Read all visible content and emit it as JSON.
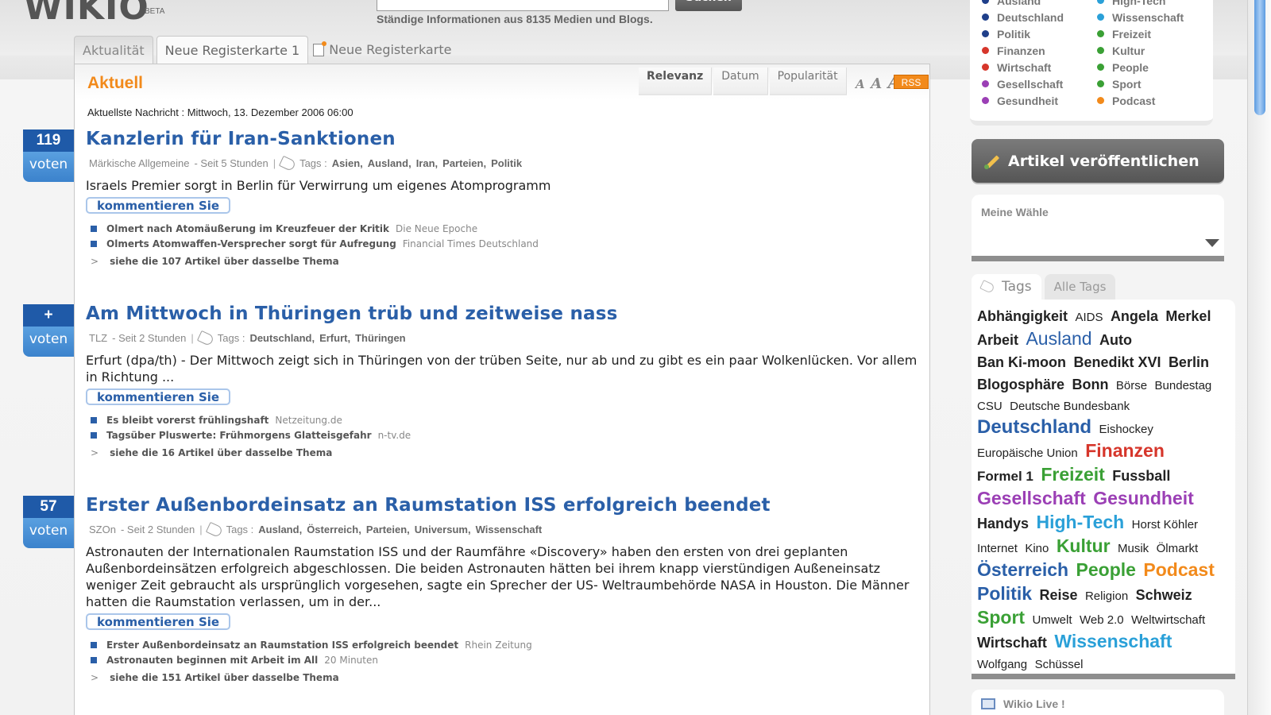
{
  "header": {
    "logo_text": "WIKIO",
    "beta_label": "BETA",
    "search_button": "Suchen",
    "search_value": "",
    "search_info": "Ständige Informationen aus 8135 Medien und Blogs."
  },
  "tabs": [
    {
      "label": "Aktualität",
      "active": true
    },
    {
      "label": "Neue Registerkarte 1",
      "active": false
    },
    {
      "label": "Neue Registerkarte",
      "active": false,
      "new": true
    }
  ],
  "main": {
    "section_title": "Aktuell",
    "sort_tabs": [
      "Relevanz",
      "Datum",
      "Popularität"
    ],
    "font_size_labels": [
      "A",
      "A",
      "A"
    ],
    "rss_label": "RSS",
    "latest_label": "Aktuellste Nachricht : Mittwoch, 13. Dezember 2006 06:00"
  },
  "articles": [
    {
      "vote_count": "119",
      "vote_label": "voten",
      "title": "Kanzlerin für Iran-Sanktionen",
      "source": "Märkische Allgemeine",
      "time": "- Seit 5 Stunden",
      "tags_label": "Tags :",
      "tags": [
        "Asien,",
        "Ausland,",
        "Iran,",
        "Parteien,",
        "Politik"
      ],
      "description": "Israels Premier sorgt in Berlin für Verwirrung um eigenes Atomprogramm",
      "comment_label": "kommentieren Sie",
      "related": [
        {
          "title": "Olmert nach Atomäußerung im Kreuzfeuer der Kritik",
          "source": "Die Neue Epoche"
        },
        {
          "title": "Olmerts Atomwaffen-Versprecher sorgt für Aufregung",
          "source": "Financial Times Deutschland"
        }
      ],
      "more": "siehe die 107 Artikel über dasselbe Thema"
    },
    {
      "vote_count": "+",
      "vote_label": "voten",
      "title": "Am Mittwoch in Thüringen trüb und zeitweise nass",
      "source": "TLZ",
      "time": "- Seit 2 Stunden",
      "tags_label": "Tags :",
      "tags": [
        "Deutschland,",
        "Erfurt,",
        "Thüringen"
      ],
      "description": "Erfurt (dpa/th) - Der Mittwoch zeigt sich in Thüringen von der trüben Seite, nur ab und zu gibt es ein paar Wolkenlücken. Vor allem in Richtung ...",
      "comment_label": "kommentieren Sie",
      "related": [
        {
          "title": "Es bleibt vorerst frühlingshaft",
          "source": "Netzeitung.de"
        },
        {
          "title": "Tagsüber Pluswerte: Frühmorgens Glatteisgefahr",
          "source": "n-tv.de"
        }
      ],
      "more": "siehe die 16 Artikel über dasselbe Thema"
    },
    {
      "vote_count": "57",
      "vote_label": "voten",
      "title": "Erster Außenbordeinsatz an Raumstation ISS erfolgreich beendet",
      "source": "SZOn",
      "time": "- Seit 2 Stunden",
      "tags_label": "Tags :",
      "tags": [
        "Ausland,",
        "Österreich,",
        "Parteien,",
        "Universum,",
        "Wissenschaft"
      ],
      "description": "Astronauten der Internationalen Raumstation ISS und der Raumfähre «Discovery» haben den ersten von drei geplanten Außenbordeinsätzen erfolgreich abgeschlossen. Die beiden Astronauten hätten bei ihrem knapp vierstündigen Außeneinsatz weniger Zeit gebraucht als ursprünglich vorgesehen, sagte ein Sprecher der US- Weltraumbehörde NASA in Houston. Die Männer hatten die Raumstation verlassen, um in der...",
      "comment_label": "kommentieren Sie",
      "related": [
        {
          "title": "Erster Außenbordeinsatz an Raumstation ISS erfolgreich beendet",
          "source": "Rhein Zeitung"
        },
        {
          "title": "Astronauten beginnen mit Arbeit im All",
          "source": "20 Minuten"
        }
      ],
      "more": "siehe die 151 Artikel über dasselbe Thema"
    }
  ],
  "categories": {
    "left": [
      {
        "label": "Ausland",
        "color": "#1f3f8a"
      },
      {
        "label": "Deutschland",
        "color": "#1f3f8a"
      },
      {
        "label": "Politik",
        "color": "#1f3f8a"
      },
      {
        "label": "Finanzen",
        "color": "#d6362b"
      },
      {
        "label": "Wirtschaft",
        "color": "#d6362b"
      },
      {
        "label": "Gesellschaft",
        "color": "#9b3fb5"
      },
      {
        "label": "Gesundheit",
        "color": "#9b3fb5"
      }
    ],
    "right": [
      {
        "label": "High-Tech",
        "color": "#2aa0d8"
      },
      {
        "label": "Wissenschaft",
        "color": "#2aa0d8"
      },
      {
        "label": "Freizeit",
        "color": "#3aa035"
      },
      {
        "label": "Kultur",
        "color": "#3aa035"
      },
      {
        "label": "People",
        "color": "#3aa035"
      },
      {
        "label": "Sport",
        "color": "#3aa035"
      },
      {
        "label": "Podcast",
        "color": "#f28a1b"
      }
    ]
  },
  "sidebar": {
    "publish_label": "Artikel veröffentlichen",
    "wahl_label": "Meine Wähle",
    "tags_tab": "Tags",
    "all_tags_tab": "Alle Tags",
    "live_label": "Wikio Live !"
  },
  "tag_cloud": [
    {
      "t": "Abhängigkeit",
      "s": 18,
      "c": "#222",
      "b": true
    },
    {
      "t": "AIDS",
      "s": 15,
      "c": "#222",
      "b": false
    },
    {
      "t": "Angela",
      "s": 18,
      "c": "#222",
      "b": true
    },
    {
      "t": "Merkel",
      "s": 18,
      "c": "#222",
      "b": true
    },
    {
      "t": "Arbeit",
      "s": 18,
      "c": "#222",
      "b": true
    },
    {
      "t": "Ausland",
      "s": 23,
      "c": "#2a5fa8",
      "b": false
    },
    {
      "t": "Auto",
      "s": 18,
      "c": "#222",
      "b": true
    },
    {
      "t": "Ban Ki-moon",
      "s": 18,
      "c": "#222",
      "b": true
    },
    {
      "t": "Benedikt XVI",
      "s": 18,
      "c": "#222",
      "b": true
    },
    {
      "t": "Berlin",
      "s": 18,
      "c": "#222",
      "b": true
    },
    {
      "t": "Blogosphäre",
      "s": 18,
      "c": "#222",
      "b": true
    },
    {
      "t": "Bonn",
      "s": 18,
      "c": "#222",
      "b": true
    },
    {
      "t": "Börse",
      "s": 15,
      "c": "#222",
      "b": false
    },
    {
      "t": "Bundestag",
      "s": 15,
      "c": "#222",
      "b": false
    },
    {
      "t": "CSU",
      "s": 15,
      "c": "#222",
      "b": false
    },
    {
      "t": "Deutsche Bundesbank",
      "s": 15,
      "c": "#222",
      "b": false
    },
    {
      "t": "Deutschland",
      "s": 24,
      "c": "#2a5fa8",
      "b": true
    },
    {
      "t": "Eishockey",
      "s": 15,
      "c": "#222",
      "b": false
    },
    {
      "t": "Europäische Union",
      "s": 15,
      "c": "#222",
      "b": false
    },
    {
      "t": "Finanzen",
      "s": 23,
      "c": "#d6362b",
      "b": true
    },
    {
      "t": "Formel 1",
      "s": 17,
      "c": "#222",
      "b": true
    },
    {
      "t": "Freizeit",
      "s": 23,
      "c": "#3aa035",
      "b": true
    },
    {
      "t": "Fussball",
      "s": 18,
      "c": "#222",
      "b": true
    },
    {
      "t": "Gesellschaft",
      "s": 23,
      "c": "#9b3fb5",
      "b": true
    },
    {
      "t": "Gesundheit",
      "s": 23,
      "c": "#9b3fb5",
      "b": true
    },
    {
      "t": "Handys",
      "s": 18,
      "c": "#222",
      "b": true
    },
    {
      "t": "High-Tech",
      "s": 23,
      "c": "#2aa0d8",
      "b": true
    },
    {
      "t": "Horst Köhler",
      "s": 15,
      "c": "#222",
      "b": false
    },
    {
      "t": "Internet",
      "s": 15,
      "c": "#222",
      "b": false
    },
    {
      "t": "Kino",
      "s": 15,
      "c": "#222",
      "b": false
    },
    {
      "t": "Kultur",
      "s": 23,
      "c": "#3aa035",
      "b": true
    },
    {
      "t": "Musik",
      "s": 15,
      "c": "#222",
      "b": false
    },
    {
      "t": "Ölmarkt",
      "s": 15,
      "c": "#222",
      "b": false
    },
    {
      "t": "Österreich",
      "s": 23,
      "c": "#2a5fa8",
      "b": true
    },
    {
      "t": "People",
      "s": 23,
      "c": "#3aa035",
      "b": true
    },
    {
      "t": "Podcast",
      "s": 23,
      "c": "#f28a1b",
      "b": true
    },
    {
      "t": "Politik",
      "s": 23,
      "c": "#2a5fa8",
      "b": true
    },
    {
      "t": "Reise",
      "s": 18,
      "c": "#222",
      "b": true
    },
    {
      "t": "Religion",
      "s": 15,
      "c": "#222",
      "b": false
    },
    {
      "t": "Schweiz",
      "s": 18,
      "c": "#222",
      "b": true
    },
    {
      "t": "Sport",
      "s": 23,
      "c": "#3aa035",
      "b": true
    },
    {
      "t": "Umwelt",
      "s": 15,
      "c": "#222",
      "b": false
    },
    {
      "t": "Web 2.0",
      "s": 15,
      "c": "#222",
      "b": false
    },
    {
      "t": "Weltwirtschaft",
      "s": 15,
      "c": "#222",
      "b": false
    },
    {
      "t": "Wirtschaft",
      "s": 18,
      "c": "#222",
      "b": true
    },
    {
      "t": "Wissenschaft",
      "s": 23,
      "c": "#2aa0d8",
      "b": true
    },
    {
      "t": "Wolfgang",
      "s": 15,
      "c": "#222",
      "b": false
    },
    {
      "t": "Schüssel",
      "s": 15,
      "c": "#222",
      "b": false
    }
  ]
}
